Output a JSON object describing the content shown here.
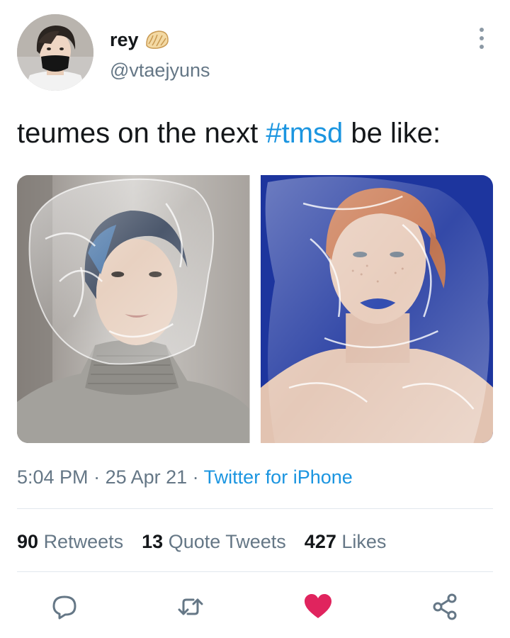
{
  "tweet": {
    "display_name": "rey",
    "name_emoji": "dumpling-emoji",
    "handle": "@vtaejyuns",
    "text_before": "teumes on the next ",
    "hashtag": "#tmsd",
    "text_after": " be like:",
    "time": "5:04 PM",
    "separator": " · ",
    "date": "25 Apr 21",
    "source": "Twitter for iPhone"
  },
  "stats": {
    "retweets_count": "90",
    "retweets_label": "Retweets",
    "quotes_count": "13",
    "quotes_label": "Quote Tweets",
    "likes_count": "427",
    "likes_label": "Likes"
  },
  "actions": {
    "reply_icon": "reply-icon",
    "retweet_icon": "retweet-icon",
    "like_icon": "heart-icon",
    "share_icon": "share-icon",
    "liked": true
  },
  "colors": {
    "link": "#1b95e0",
    "secondary_text": "#657786",
    "like": "#e0245e",
    "icon": "#657786"
  }
}
